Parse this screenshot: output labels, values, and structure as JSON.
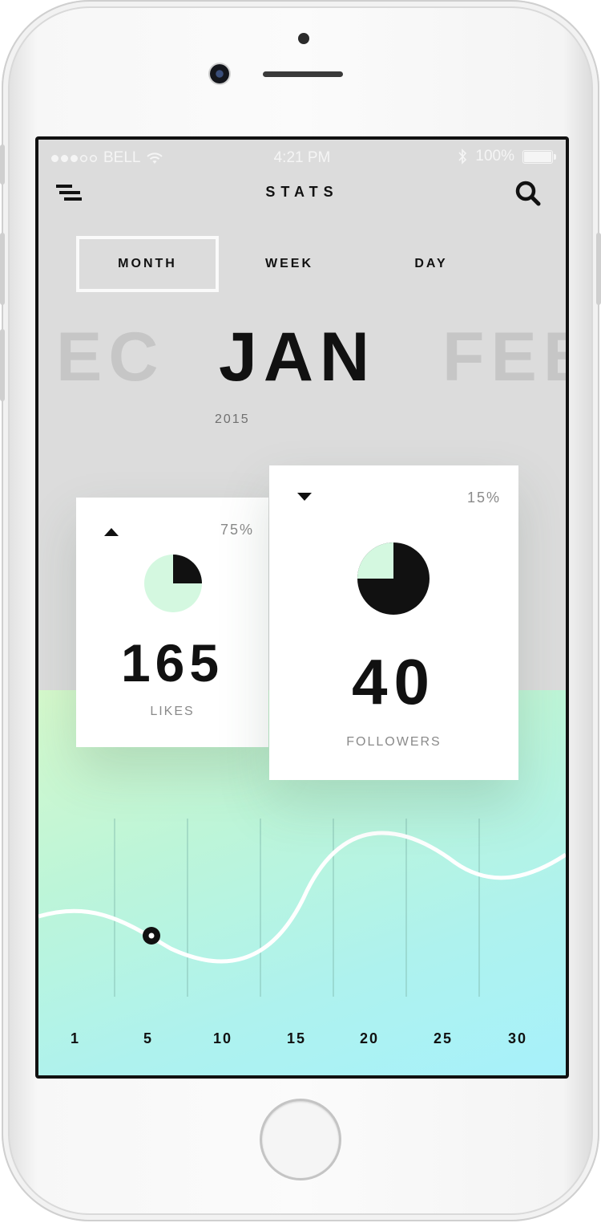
{
  "status_bar": {
    "carrier": "BELL",
    "time": "4:21 PM",
    "battery": "100%",
    "signal_bars": 5,
    "signal_filled": 3
  },
  "header": {
    "title": "STATS"
  },
  "tabs": [
    {
      "label": "MONTH",
      "active": true
    },
    {
      "label": "WEEK",
      "active": false
    },
    {
      "label": "DAY",
      "active": false
    }
  ],
  "months": {
    "previous": "EC",
    "current": "JAN",
    "next": "FEB",
    "year": "2015"
  },
  "cards": [
    {
      "label": "LIKES",
      "value": "165",
      "percent": "75%",
      "trend": "up",
      "pie_fraction": 0.25
    },
    {
      "label": "FOLLOWERS",
      "value": "40",
      "percent": "15%",
      "trend": "down",
      "pie_fraction": 0.75
    }
  ],
  "chart_data": {
    "type": "line",
    "x_ticks": [
      "1",
      "5",
      "10",
      "15",
      "20",
      "25",
      "30"
    ],
    "grid": true,
    "highlighted_point": {
      "x": 5
    }
  },
  "colors": {
    "accent": "#111111",
    "pie_light": "#d4f8e0",
    "gradient_top": "#d6f9cc",
    "gradient_bottom": "#a7f1fb"
  },
  "icons": {
    "menu": "menu-icon",
    "search": "search-icon",
    "wifi": "wifi-icon",
    "bluetooth": "bluetooth-icon",
    "battery": "battery-icon"
  }
}
